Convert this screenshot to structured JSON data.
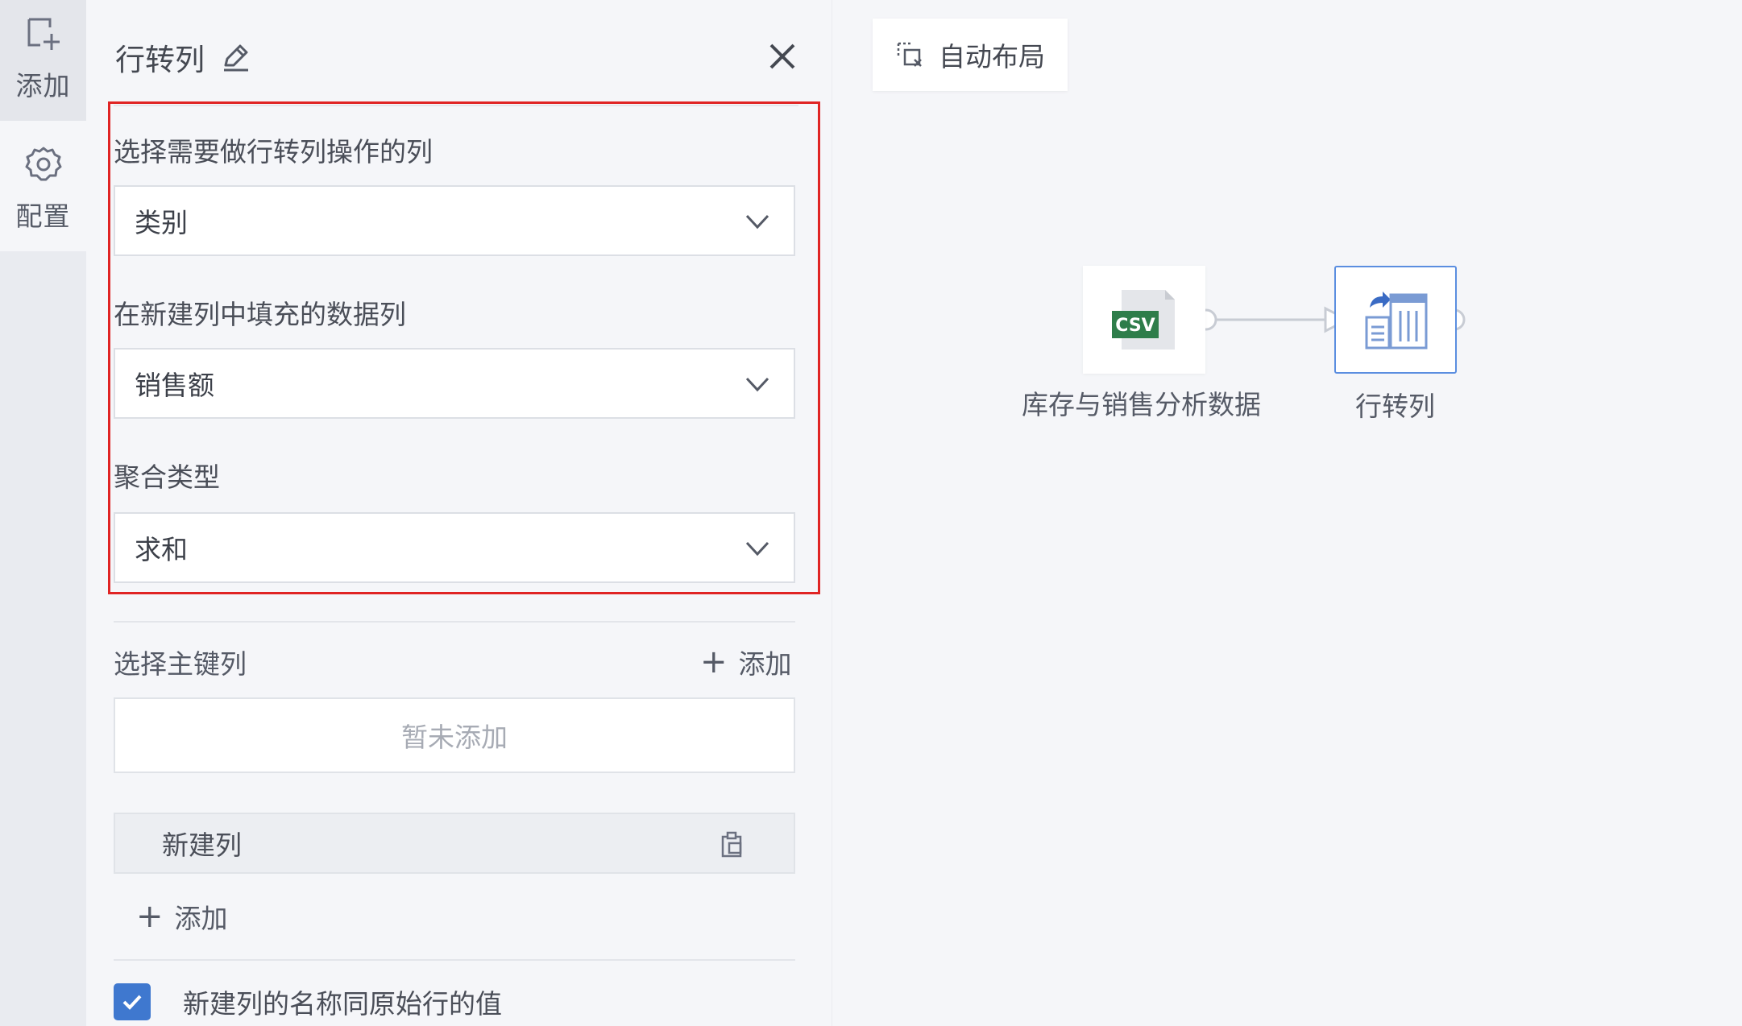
{
  "rail": {
    "add_label": "添加",
    "config_label": "配置",
    "add_icon": "add-node-icon",
    "config_icon": "gear-icon"
  },
  "panel": {
    "title": "行转列",
    "fields": [
      {
        "label": "选择需要做行转列操作的列",
        "value": "类别"
      },
      {
        "label": "在新建列中填充的数据列",
        "value": "销售额"
      },
      {
        "label": "聚合类型",
        "value": "求和"
      }
    ],
    "primary_key": {
      "label": "选择主键列",
      "add_label": "添加",
      "empty_text": "暂未添加"
    },
    "new_column": {
      "label": "新建列",
      "add_label": "添加"
    },
    "checkbox": {
      "label": "新建列的名称同原始行的值",
      "checked": true
    }
  },
  "canvas": {
    "auto_layout_label": "自动布局",
    "nodes": [
      {
        "label": "库存与销售分析数据",
        "badge": "CSV"
      },
      {
        "label": "行转列"
      }
    ]
  },
  "colors": {
    "accent": "#3f78cf",
    "highlight": "#e02424",
    "csv_green": "#2e7d4a",
    "node_blue": "#5b8ee0"
  }
}
